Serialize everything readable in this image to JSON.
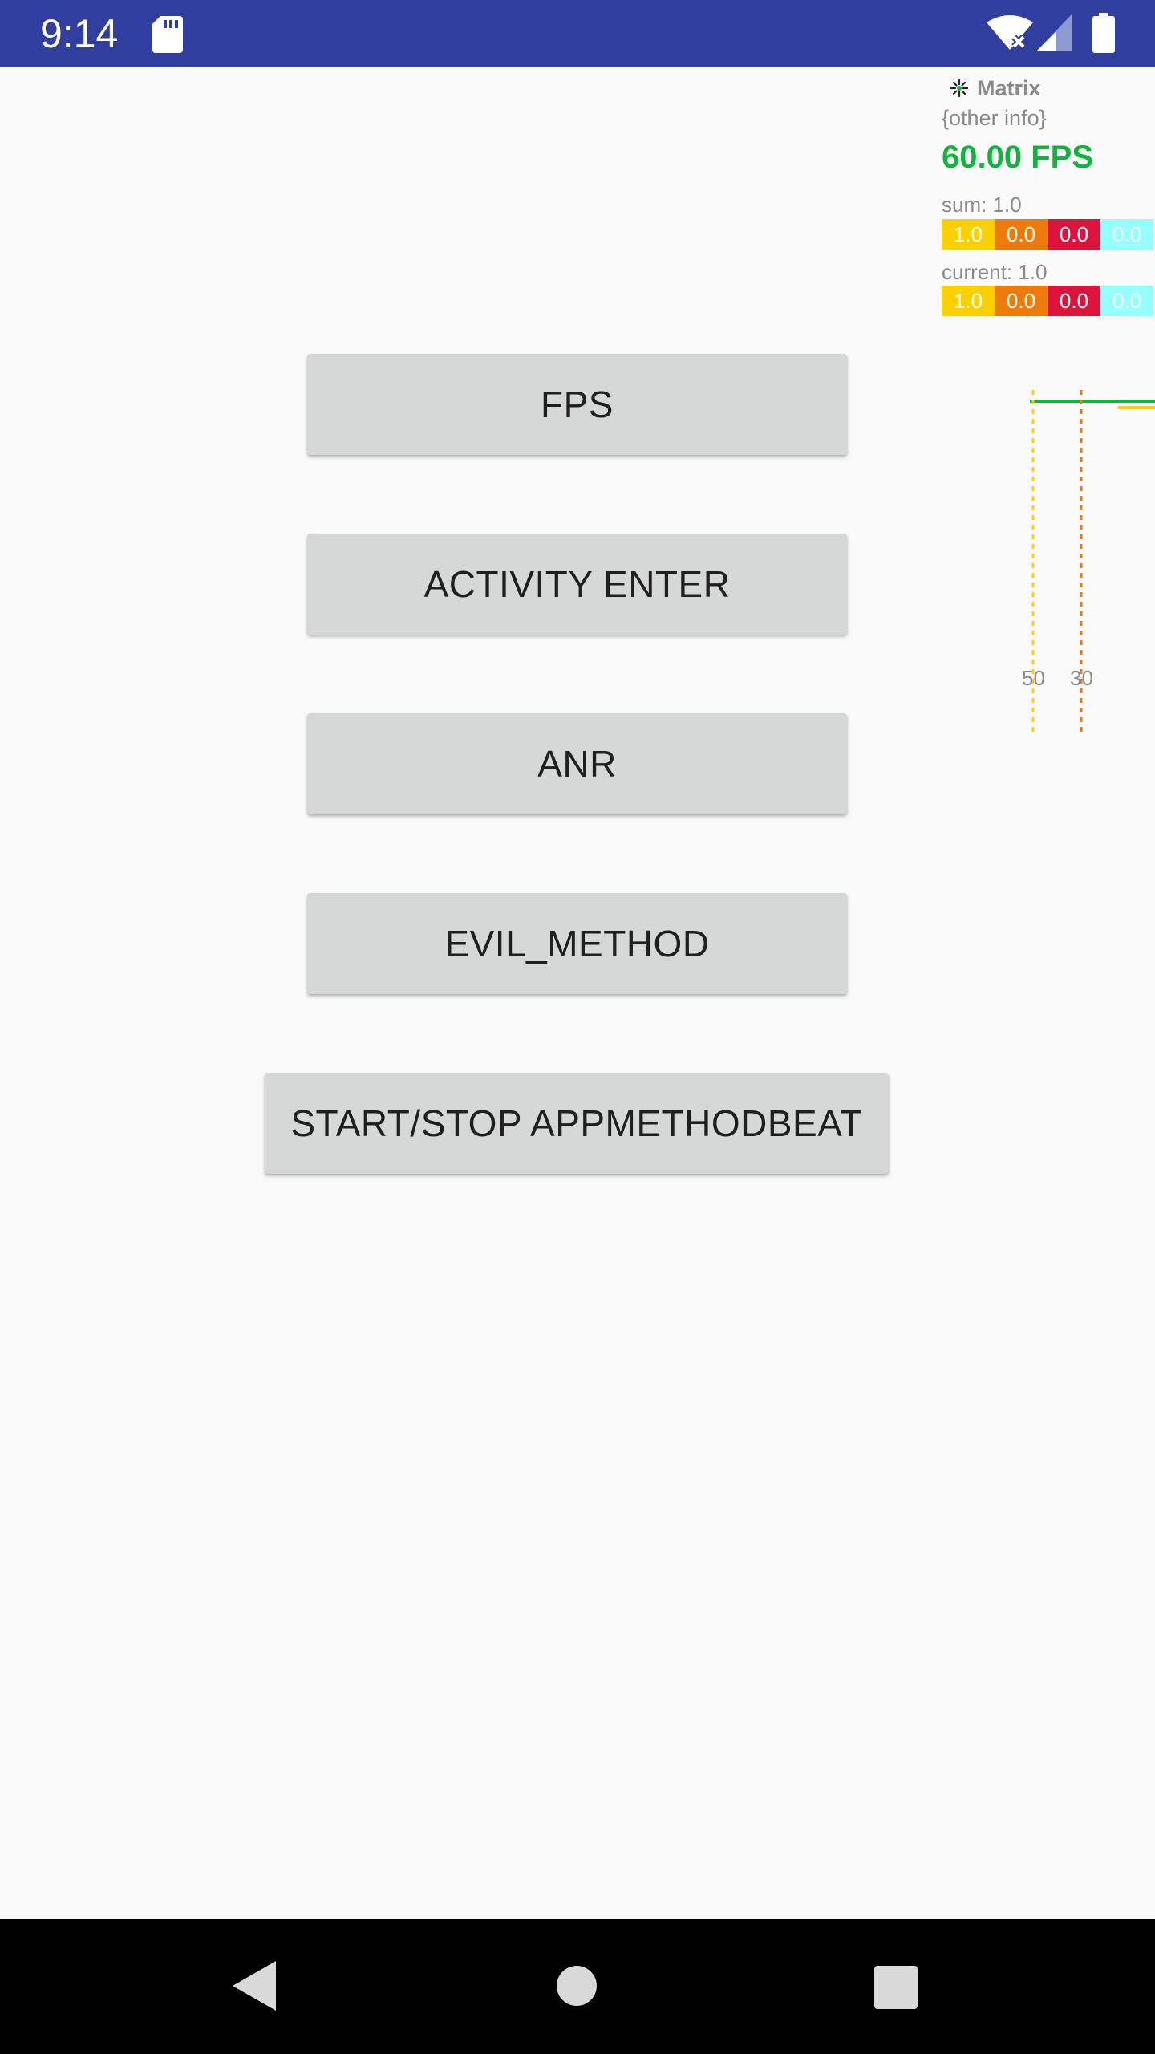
{
  "status_bar": {
    "time": "9:14",
    "background": "#303f9f",
    "icons": [
      "sd-card-icon",
      "wifi-off-icon",
      "cell-signal-icon",
      "battery-icon"
    ]
  },
  "buttons": {
    "fps": "FPS",
    "activity_enter": "ACTIVITY ENTER",
    "anr": "ANR",
    "evil_method": "EVIL_METHOD",
    "appmethodbeat": "START/STOP APPMETHODBEAT"
  },
  "matrix": {
    "title": "Matrix",
    "info": "{other info}",
    "fps": "60.00 FPS",
    "sum_label": "sum: 1.0",
    "current_label": "current: 1.0",
    "sum_values": [
      "1.0",
      "0.0",
      "0.0",
      "0.0"
    ],
    "current_values": [
      "1.0",
      "0.0",
      "0.0",
      "0.0"
    ],
    "tick_50": "50",
    "tick_30": "30",
    "colors": {
      "fps_text": "#13b13f",
      "frozen": "#fad000",
      "high": "#ec7b0c",
      "middle": "#dc143c",
      "normal": "#96ffff"
    }
  },
  "nav_bar": {
    "icons": [
      "back-icon",
      "home-icon",
      "recents-icon"
    ]
  }
}
